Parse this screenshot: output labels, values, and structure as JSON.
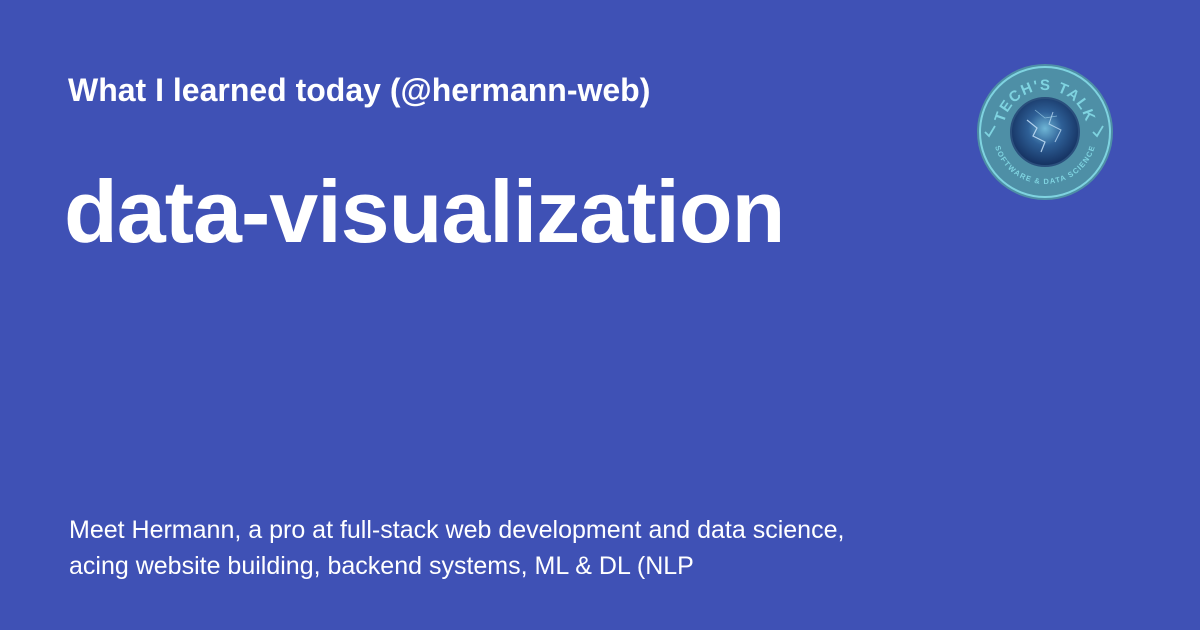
{
  "card": {
    "subtitle": "What I learned today (@hermann-web)",
    "title": "data-visualization",
    "description": "Meet Hermann, a pro at full-stack web development and data science, acing website building, backend systems, ML & DL (NLP"
  },
  "logo": {
    "top_text": "TECH'S TALK",
    "bottom_text": "SOFTWARE & DATA SCIENCE"
  },
  "colors": {
    "background": "#3f51b5",
    "text": "#ffffff",
    "logo_ring": "#4e8fa6",
    "logo_text": "#7fd3e0",
    "logo_center": "#1e3f7a"
  }
}
